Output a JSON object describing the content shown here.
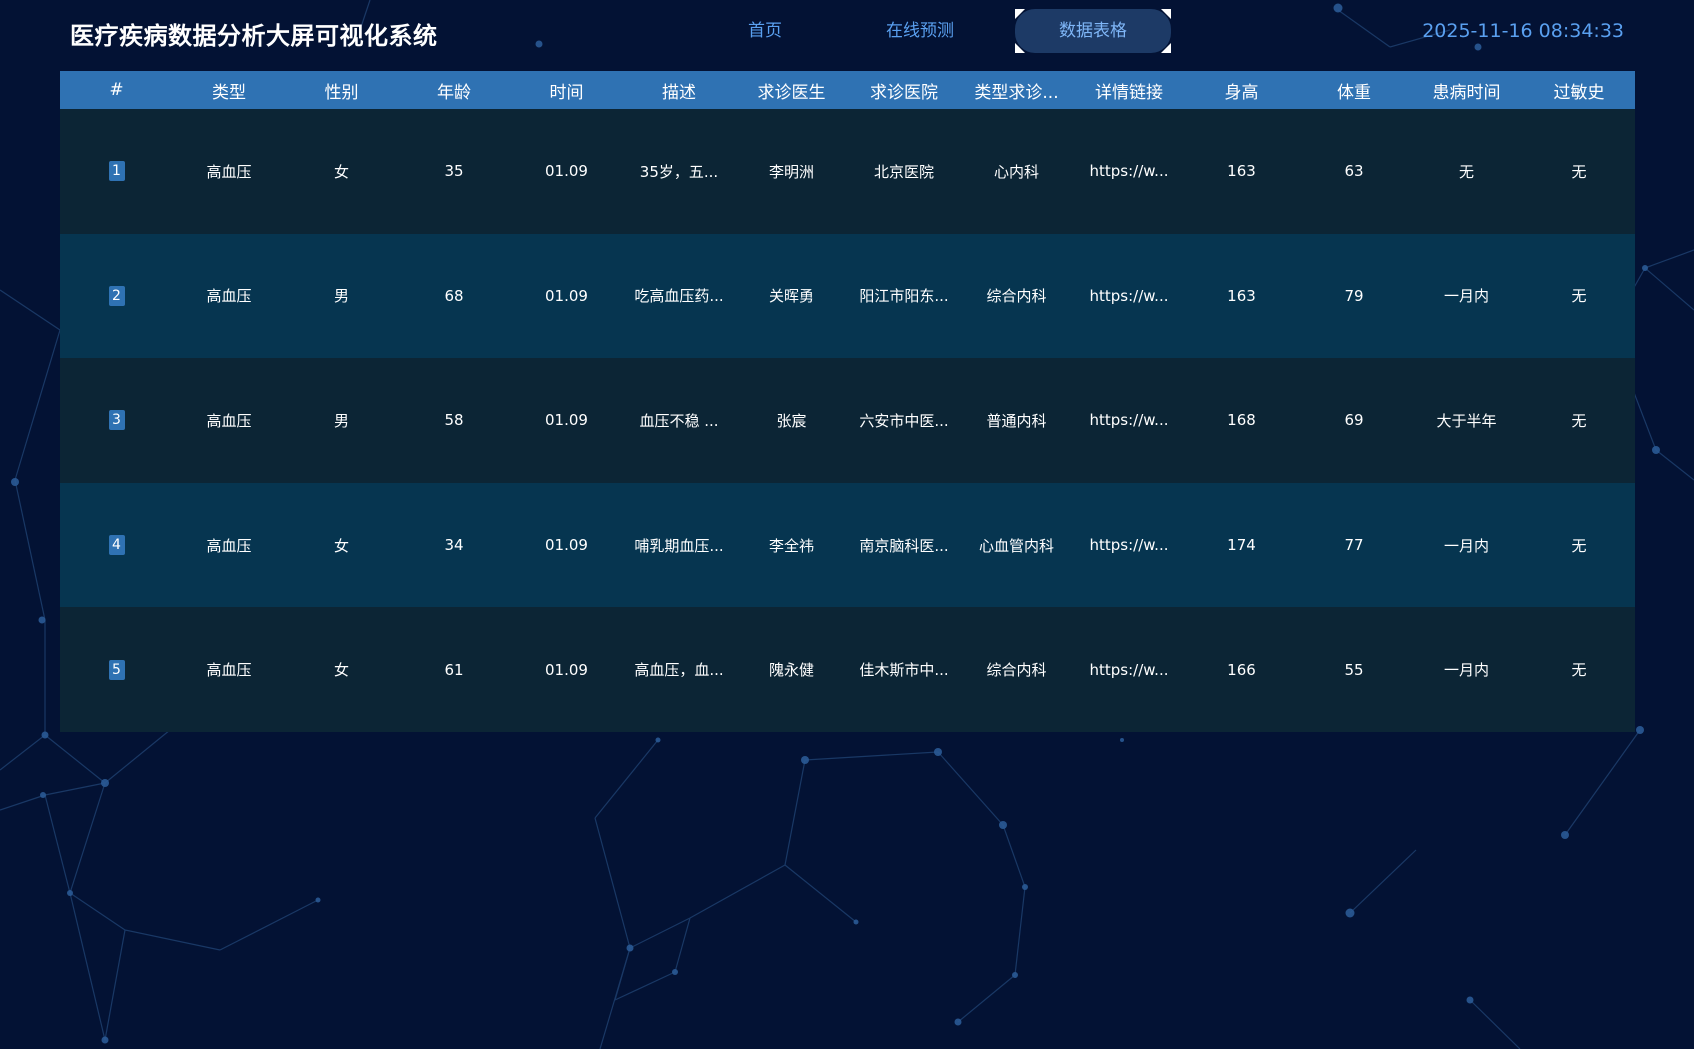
{
  "app_title": "医疗疾病数据分析大屏可视化系统",
  "nav": {
    "tabs": [
      {
        "label": "首页",
        "active": false
      },
      {
        "label": "在线预测",
        "active": false
      },
      {
        "label": "数据表格",
        "active": true
      }
    ]
  },
  "clock": "2025-11-16 08:34:33",
  "colors": {
    "background": "#031234",
    "header_row": "#2f72b3",
    "row_odd": "#0c2535",
    "row_even": "#063550",
    "accent_text": "#5aa0f0",
    "active_tab": "#1d3a66"
  },
  "table": {
    "columns": [
      "#",
      "类型",
      "性别",
      "年龄",
      "时间",
      "描述",
      "求诊医生",
      "求诊医院",
      "类型求诊...",
      "详情链接",
      "身高",
      "体重",
      "患病时间",
      "过敏史"
    ],
    "rows": [
      [
        "1",
        "高血压",
        "女",
        "35",
        "01.09",
        "35岁，五...",
        "李明洲",
        "北京医院",
        "心内科",
        "https://w...",
        "163",
        "63",
        "无",
        "无"
      ],
      [
        "2",
        "高血压",
        "男",
        "68",
        "01.09",
        "吃高血压药...",
        "关晖勇",
        "阳江市阳东...",
        "综合内科",
        "https://w...",
        "163",
        "79",
        "一月内",
        "无"
      ],
      [
        "3",
        "高血压",
        "男",
        "58",
        "01.09",
        "血压不稳 ...",
        "张宸",
        "六安市中医...",
        "普通内科",
        "https://w...",
        "168",
        "69",
        "大于半年",
        "无"
      ],
      [
        "4",
        "高血压",
        "女",
        "34",
        "01.09",
        "哺乳期血压...",
        "李全祎",
        "南京脑科医...",
        "心血管内科",
        "https://w...",
        "174",
        "77",
        "一月内",
        "无"
      ],
      [
        "5",
        "高血压",
        "女",
        "61",
        "01.09",
        "高血压，血...",
        "隗永健",
        "佳木斯市中...",
        "综合内科",
        "https://w...",
        "166",
        "55",
        "一月内",
        "无"
      ]
    ]
  }
}
